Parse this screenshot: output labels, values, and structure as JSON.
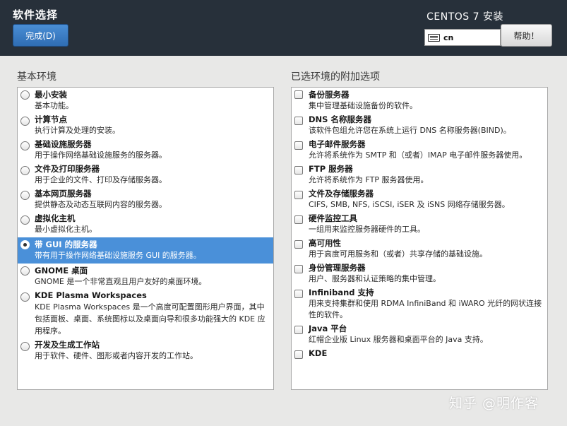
{
  "header": {
    "page_title": "软件选择",
    "done_label": "完成(D)",
    "product_title": "CENTOS 7 安装",
    "keyboard_layout": "cn",
    "help_label": "帮助！"
  },
  "left": {
    "title": "基本环境",
    "items": [
      {
        "title": "最小安装",
        "desc": "基本功能。"
      },
      {
        "title": "计算节点",
        "desc": "执行计算及处理的安装。"
      },
      {
        "title": "基础设施服务器",
        "desc": "用于操作网络基础设施服务的服务器。"
      },
      {
        "title": "文件及打印服务器",
        "desc": "用于企业的文件、打印及存储服务器。"
      },
      {
        "title": "基本网页服务器",
        "desc": "提供静态及动态互联网内容的服务器。"
      },
      {
        "title": "虚拟化主机",
        "desc": "最小虚拟化主机。"
      },
      {
        "title": "带 GUI 的服务器",
        "desc": "带有用于操作网络基础设施服务 GUI 的服务器。"
      },
      {
        "title": "GNOME 桌面",
        "desc": "GNOME 是一个非常直观且用户友好的桌面环境。"
      },
      {
        "title": "KDE Plasma Workspaces",
        "desc": "KDE Plasma Workspaces 是一个高度可配置图形用户界面，其中包括面板、桌面、系统图标以及桌面向导和很多功能强大的 KDE 应用程序。"
      },
      {
        "title": "开发及生成工作站",
        "desc": "用于软件、硬件、图形或者内容开发的工作站。"
      }
    ]
  },
  "right": {
    "title": "已选环境的附加选项",
    "items": [
      {
        "title": "备份服务器",
        "desc": "集中管理基础设施备份的软件。"
      },
      {
        "title": "DNS 名称服务器",
        "desc": "该软件包组允许您在系统上运行 DNS 名称服务器(BIND)。"
      },
      {
        "title": "电子邮件服务器",
        "desc": "允许将系统作为 SMTP 和（或者）IMAP 电子邮件服务器使用。"
      },
      {
        "title": "FTP 服务器",
        "desc": "允许将系统作为 FTP 服务器使用。"
      },
      {
        "title": "文件及存储服务器",
        "desc": "CIFS, SMB, NFS, iSCSI, iSER 及 iSNS 网络存储服务器。"
      },
      {
        "title": "硬件监控工具",
        "desc": "一组用来监控服务器硬件的工具。"
      },
      {
        "title": "高可用性",
        "desc": "用于高度可用服务和（或者）共享存储的基础设施。"
      },
      {
        "title": "身份管理服务器",
        "desc": "用户、服务器和认证策略的集中管理。"
      },
      {
        "title": "Infiniband 支持",
        "desc": "用来支持集群和使用 RDMA InfiniBand 和 iWARO 光纤的网状连接性的软件。"
      },
      {
        "title": "Java 平台",
        "desc": "红帽企业版 Linux 服务器和桌面平台的 Java 支持。"
      },
      {
        "title": "KDE",
        "desc": ""
      }
    ]
  },
  "watermark": "知乎 @明作客"
}
